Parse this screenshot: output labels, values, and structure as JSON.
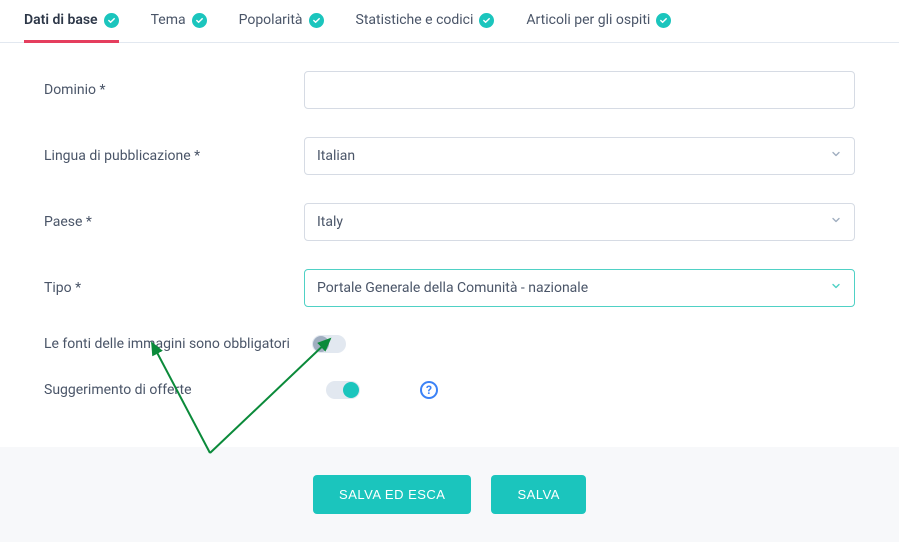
{
  "tabs": [
    {
      "label": "Dati di base",
      "active": true
    },
    {
      "label": "Tema",
      "active": false
    },
    {
      "label": "Popolarità",
      "active": false
    },
    {
      "label": "Statistiche e codici",
      "active": false
    },
    {
      "label": "Articoli per gli ospiti",
      "active": false
    }
  ],
  "fields": {
    "domain_label": "Dominio *",
    "domain_value": "",
    "language_label": "Lingua di pubblicazione *",
    "language_value": "Italian",
    "country_label": "Paese *",
    "country_value": "Italy",
    "type_label": "Tipo *",
    "type_value": "Portale Generale della Comunità - nazionale",
    "image_sources_label": "Le fonti delle immagini sono obbligatori",
    "image_sources_on": false,
    "offers_label": "Suggerimento di offerte",
    "offers_on": true
  },
  "help_glyph": "?",
  "buttons": {
    "save_exit": "SALVA ED ESCA",
    "save": "SALVA"
  },
  "colors": {
    "accent": "#1bc5bd",
    "tab_underline": "#e53e5e",
    "help_border": "#3b82f6"
  }
}
